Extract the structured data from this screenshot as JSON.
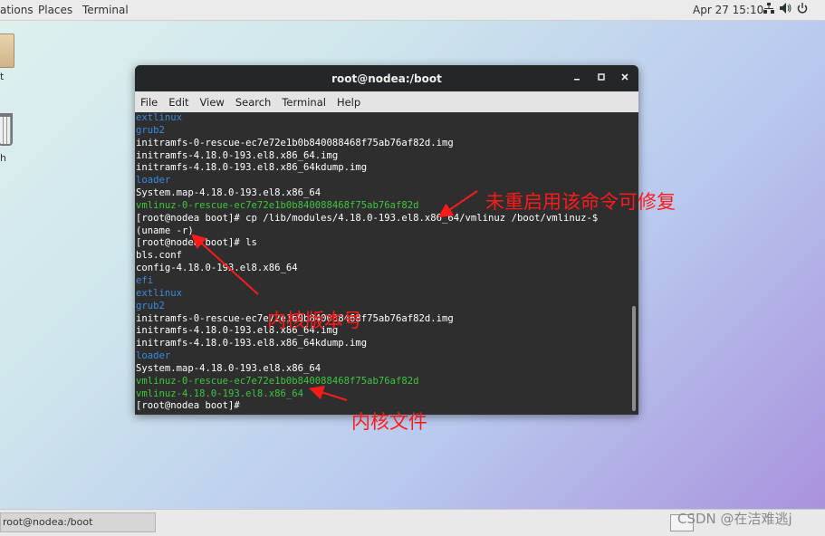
{
  "topbar": {
    "applications_label": "ations",
    "places_label": "Places",
    "terminal_label": "Terminal",
    "clock": "Apr 27  15:10"
  },
  "desktop": {
    "folder_label": "t",
    "trash_label": "h"
  },
  "window": {
    "title": "root@nodea:/boot",
    "menu": [
      "File",
      "Edit",
      "View",
      "Search",
      "Terminal",
      "Help"
    ]
  },
  "terminal_lines": [
    {
      "text": "extlinux",
      "color": "blue"
    },
    {
      "text": "grub2",
      "color": "blue"
    },
    {
      "text": "initramfs-0-rescue-ec7e72e1b0b840088468f75ab76af82d.img",
      "color": "white"
    },
    {
      "text": "initramfs-4.18.0-193.el8.x86_64.img",
      "color": "white"
    },
    {
      "text": "initramfs-4.18.0-193.el8.x86_64kdump.img",
      "color": "white"
    },
    {
      "text": "loader",
      "color": "blue"
    },
    {
      "text": "System.map-4.18.0-193.el8.x86_64",
      "color": "white"
    },
    {
      "text": "vmlinuz-0-rescue-ec7e72e1b0b840088468f75ab76af82d",
      "color": "green"
    },
    {
      "text": "[root@nodea boot]# cp /lib/modules/4.18.0-193.el8.x86_64/vmlinuz /boot/vmlinuz-$",
      "color": "white"
    },
    {
      "text": "(uname -r)",
      "color": "white"
    },
    {
      "text": "[root@nodea boot]# ls",
      "color": "white"
    },
    {
      "text": "bls.conf",
      "color": "white"
    },
    {
      "text": "config-4.18.0-193.el8.x86_64",
      "color": "white"
    },
    {
      "text": "efi",
      "color": "blue"
    },
    {
      "text": "extlinux",
      "color": "blue"
    },
    {
      "text": "grub2",
      "color": "blue"
    },
    {
      "text": "initramfs-0-rescue-ec7e72e1b0b840088468f75ab76af82d.img",
      "color": "white"
    },
    {
      "text": "initramfs-4.18.0-193.el8.x86_64.img",
      "color": "white"
    },
    {
      "text": "initramfs-4.18.0-193.el8.x86_64kdump.img",
      "color": "white"
    },
    {
      "text": "loader",
      "color": "blue"
    },
    {
      "text": "System.map-4.18.0-193.el8.x86_64",
      "color": "white"
    },
    {
      "text": "vmlinuz-0-rescue-ec7e72e1b0b840088468f75ab76af82d",
      "color": "green"
    },
    {
      "text": "vmlinuz-4.18.0-193.el8.x86_64",
      "color": "green"
    },
    {
      "text": "[root@nodea boot]# ",
      "color": "white"
    }
  ],
  "annotations": {
    "no_reboot_fix": "未重启用该命令可修复",
    "kernel_version": "内核版本号",
    "kernel_file": "内核文件"
  },
  "taskbar": {
    "task_label": "root@nodea:/boot"
  },
  "watermark": "CSDN @在洁难逃j",
  "colors": {
    "blue": "#3a8bdf",
    "green": "#3fc43f",
    "white": "#ffffff",
    "annotation": "#ff1a1a"
  }
}
